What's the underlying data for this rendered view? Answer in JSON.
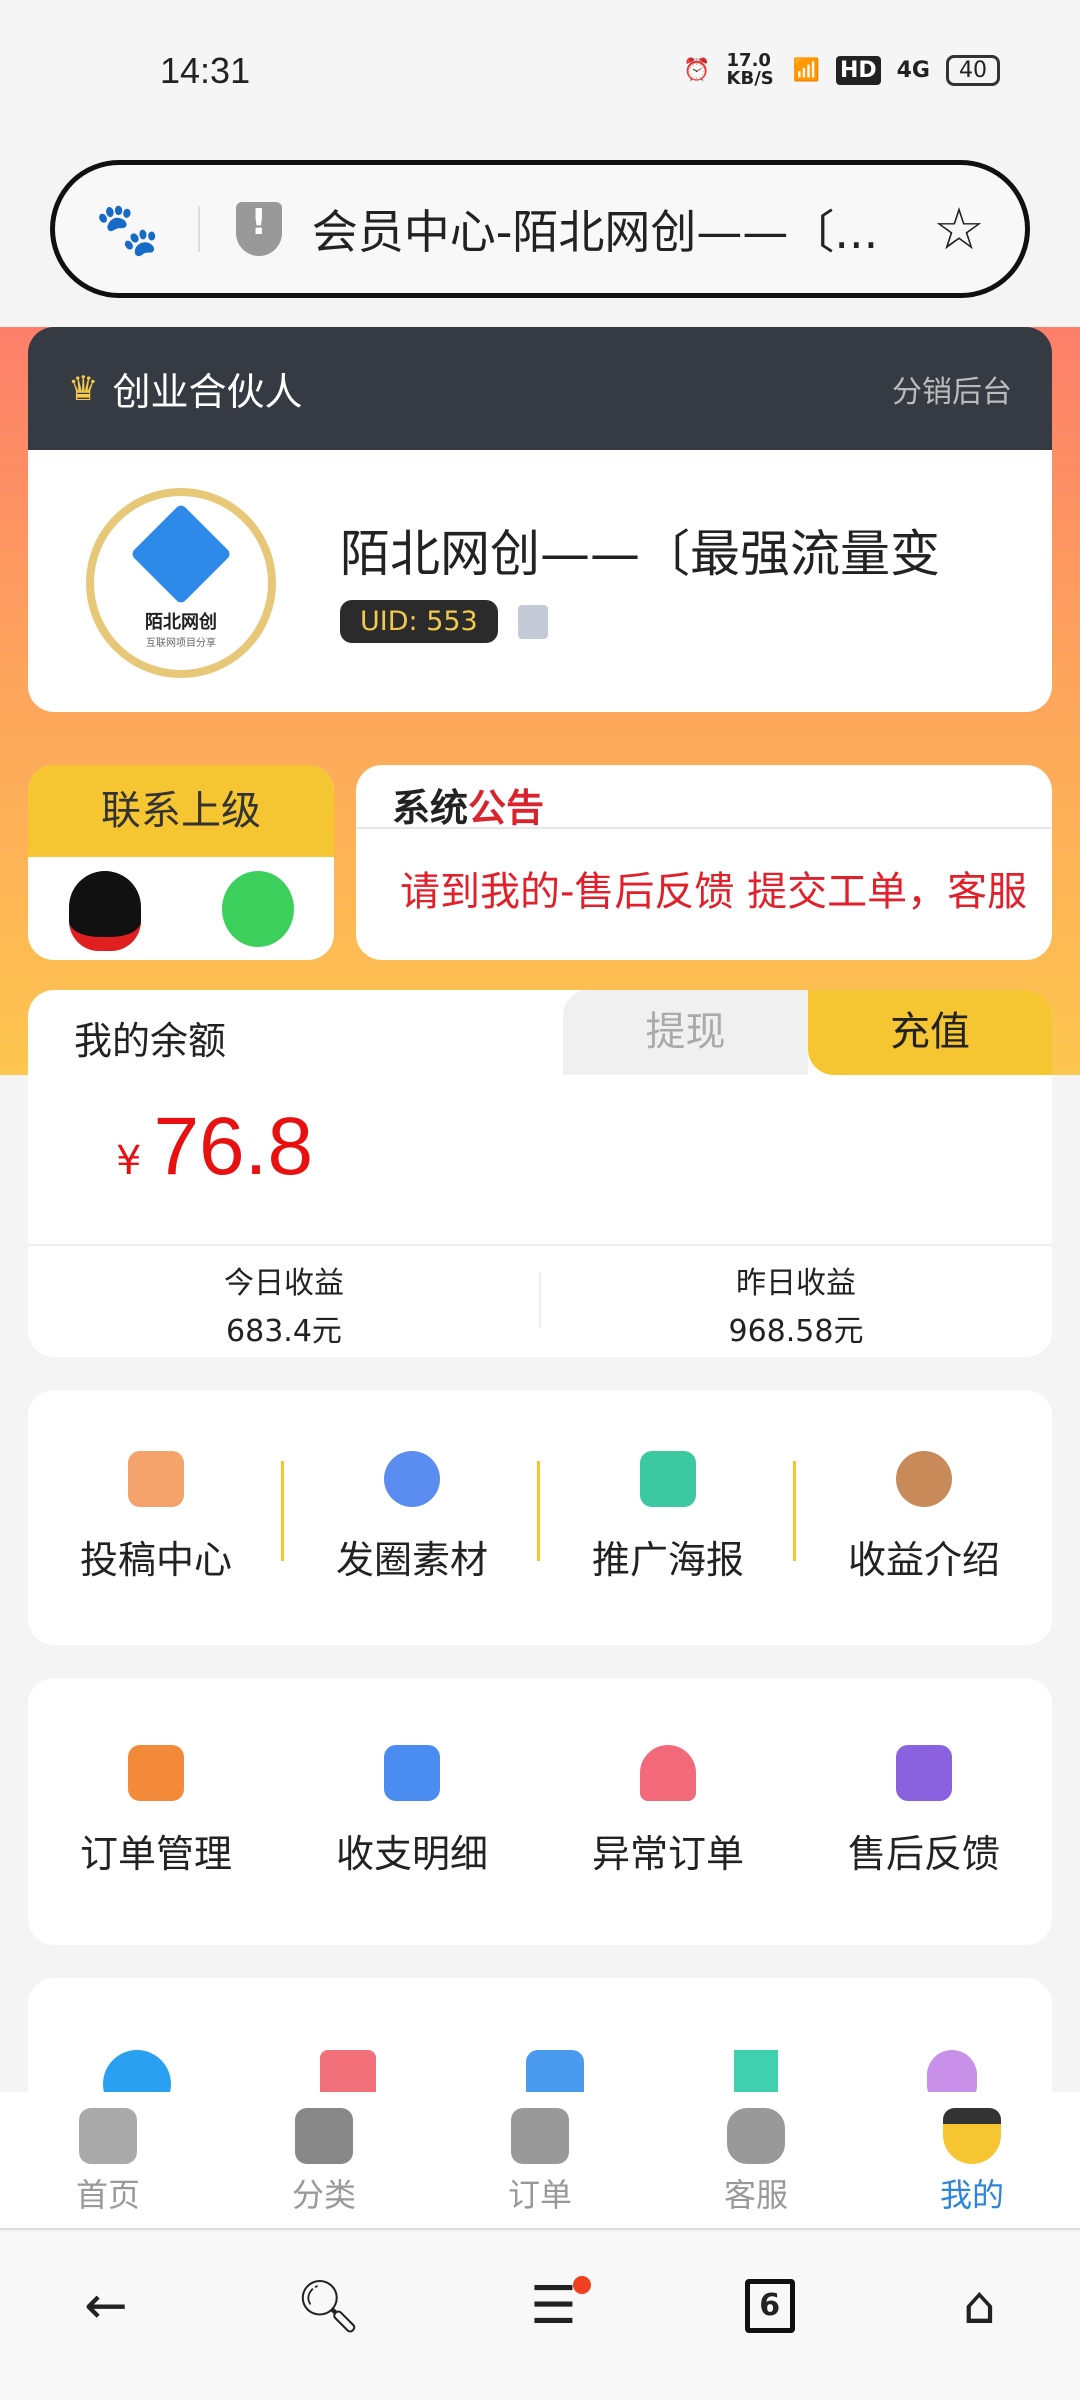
{
  "status": {
    "time": "14:31",
    "speed": "17.0 KB/S",
    "network": "4G",
    "hd": "HD",
    "battery": "40"
  },
  "browser": {
    "title": "会员中心-陌北网创——〔...",
    "tab_count": "6"
  },
  "header": {
    "title": "创业合伙人",
    "link": "分销后台"
  },
  "profile": {
    "name": "陌北网创——〔最强流量变",
    "uid": "UID: 553",
    "logo_text": "陌北网创",
    "logo_sub": "互联网项目分享"
  },
  "contact": {
    "title": "联系上级"
  },
  "notice": {
    "title_a": "系统",
    "title_b": "公告",
    "message": "请到我的-售后反馈 提交工单，客服"
  },
  "balance": {
    "label": "我的余额",
    "withdraw": "提现",
    "recharge": "充值",
    "currency": "¥",
    "amount": "76.8",
    "today_label": "今日收益",
    "today": "683.4元",
    "yesterday_label": "昨日收益",
    "yesterday": "968.58元"
  },
  "grid1": [
    {
      "label": "投稿中心",
      "color": "#f4a46a"
    },
    {
      "label": "发圈素材",
      "color": "#5b8cf0"
    },
    {
      "label": "推广海报",
      "color": "#3cc8a0"
    },
    {
      "label": "收益介绍",
      "color": "#c98a5a"
    }
  ],
  "grid2": [
    {
      "label": "订单管理",
      "color": "#f28a3a"
    },
    {
      "label": "收支明细",
      "color": "#4a8cf0"
    },
    {
      "label": "异常订单",
      "color": "#f26a7a"
    },
    {
      "label": "售后反馈",
      "color": "#8a62e0"
    }
  ],
  "grid3": [
    {
      "color": "#2aa0f0"
    },
    {
      "color": "#f2707a"
    },
    {
      "color": "#4a9af0"
    },
    {
      "color": "#40d0b0"
    },
    {
      "color": "#c890e8"
    }
  ],
  "tabbar": [
    {
      "label": "首页"
    },
    {
      "label": "分类"
    },
    {
      "label": "订单"
    },
    {
      "label": "客服"
    },
    {
      "label": "我的",
      "active": true,
      "color": "#2b86d9"
    }
  ]
}
